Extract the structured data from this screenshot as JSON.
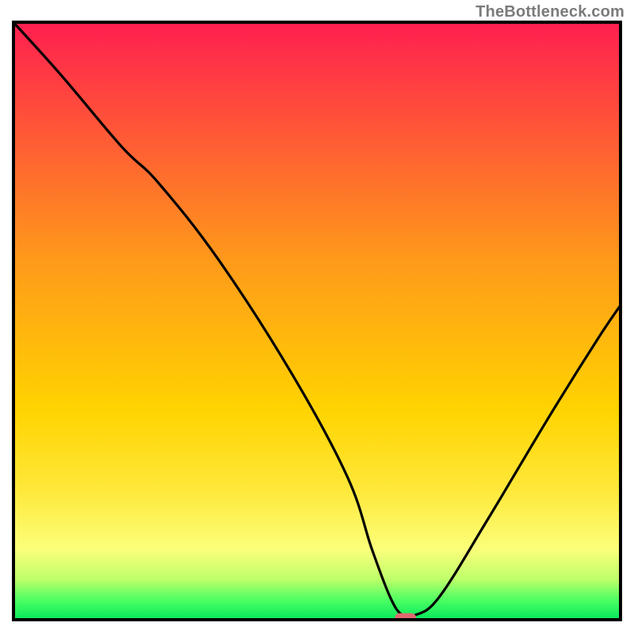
{
  "watermark": "TheBottleneck.com",
  "chart_data": {
    "type": "line",
    "title": "",
    "xlabel": "",
    "ylabel": "",
    "xlim": [
      0,
      100
    ],
    "ylim": [
      0,
      100
    ],
    "grid": false,
    "legend": false,
    "gradient_stops": [
      {
        "offset": 0,
        "color": "#ff1e50"
      },
      {
        "offset": 0.4,
        "color": "#ff9a1a"
      },
      {
        "offset": 0.65,
        "color": "#ffd400"
      },
      {
        "offset": 0.78,
        "color": "#ffe83a"
      },
      {
        "offset": 0.88,
        "color": "#fbff7a"
      },
      {
        "offset": 0.93,
        "color": "#beff6a"
      },
      {
        "offset": 0.965,
        "color": "#4bff63"
      },
      {
        "offset": 1.0,
        "color": "#00e65a"
      }
    ],
    "series": [
      {
        "name": "bottleneck-curve",
        "x": [
          0,
          8,
          18,
          24,
          34,
          46,
          55,
          59,
          62,
          64,
          66,
          70,
          78,
          88,
          96,
          100
        ],
        "values": [
          100,
          91,
          79,
          73,
          60,
          41,
          24,
          12,
          4,
          1,
          1,
          4,
          17,
          34,
          47,
          53
        ]
      }
    ],
    "marker": {
      "name": "optimal-marker",
      "x": 64.5,
      "y": 0.5,
      "width_percent": 3.5,
      "color": "#e06a6f"
    },
    "annotations": []
  }
}
